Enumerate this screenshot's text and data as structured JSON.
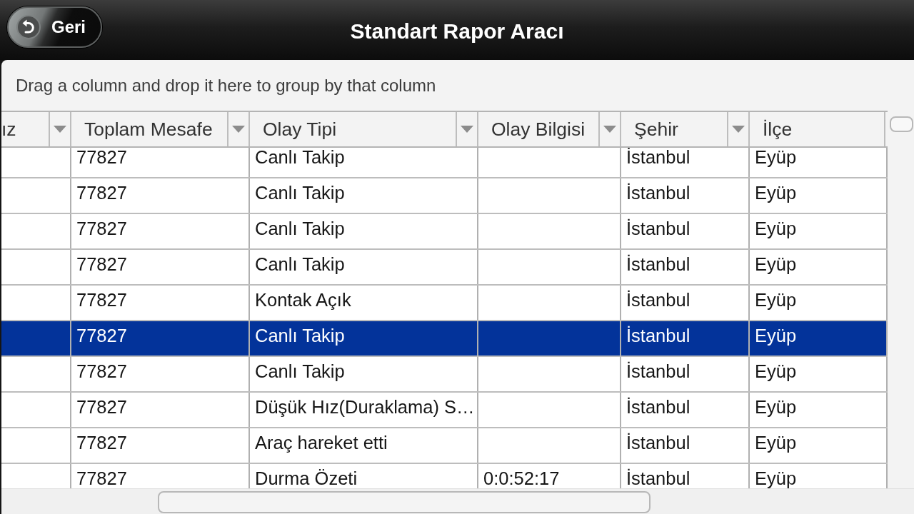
{
  "top_bar": {
    "back_button": "Geri",
    "title": "Standart Rapor Aracı"
  },
  "group_panel": {
    "hint": "Drag a column and drop it here to group by that column"
  },
  "grid": {
    "columns": [
      {
        "label": "ız",
        "menu": true
      },
      {
        "label": "Toplam Mesafe",
        "menu": true
      },
      {
        "label": "Olay Tipi",
        "menu": true
      },
      {
        "label": "Olay Bilgisi",
        "menu": true
      },
      {
        "label": "Şehir",
        "menu": true
      },
      {
        "label": "İlçe",
        "menu": false
      }
    ],
    "rows": [
      {
        "selected": false,
        "cells": [
          null,
          "77827",
          "Canlı Takip",
          null,
          "İstanbul",
          "Eyüp"
        ]
      },
      {
        "selected": false,
        "cells": [
          null,
          "77827",
          "Canlı Takip",
          null,
          "İstanbul",
          "Eyüp"
        ]
      },
      {
        "selected": false,
        "cells": [
          null,
          "77827",
          "Canlı Takip",
          null,
          "İstanbul",
          "Eyüp"
        ]
      },
      {
        "selected": false,
        "cells": [
          null,
          "77827",
          "Canlı Takip",
          null,
          "İstanbul",
          "Eyüp"
        ]
      },
      {
        "selected": false,
        "cells": [
          null,
          "77827",
          "Kontak Açık",
          null,
          "İstanbul",
          "Eyüp"
        ]
      },
      {
        "selected": true,
        "cells": [
          null,
          "77827",
          "Canlı Takip",
          null,
          "İstanbul",
          "Eyüp"
        ]
      },
      {
        "selected": false,
        "cells": [
          null,
          "77827",
          "Canlı Takip",
          null,
          "İstanbul",
          "Eyüp"
        ]
      },
      {
        "selected": false,
        "cells": [
          null,
          "77827",
          "Düşük Hız(Duraklama) S…",
          null,
          "İstanbul",
          "Eyüp"
        ]
      },
      {
        "selected": false,
        "cells": [
          null,
          "77827",
          "Araç hareket etti",
          null,
          "İstanbul",
          "Eyüp"
        ]
      },
      {
        "selected": false,
        "cells": [
          null,
          "77827",
          "Durma Özeti",
          "0:0:52:17",
          "İstanbul",
          "Eyüp"
        ]
      }
    ]
  }
}
